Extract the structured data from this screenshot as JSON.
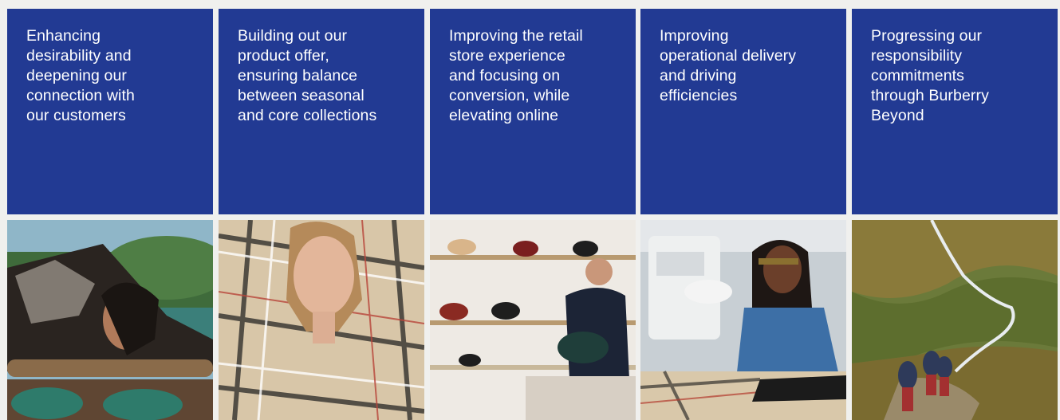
{
  "pillars": [
    {
      "text": "Enhancing\ndesirability and\ndeepening our\nconnection with\nour customers",
      "image": "woman-on-log-photo"
    },
    {
      "text": "Building out our\nproduct offer,\nensuring balance\nbetween seasonal\nand core collections",
      "image": "woman-in-check-photo"
    },
    {
      "text": "Improving the retail\nstore experience\nand focusing on\nconversion, while\nelevating online",
      "image": "store-associate-photo"
    },
    {
      "text": "Improving\noperational delivery\nand driving\nefficiencies",
      "image": "seamstress-photo"
    },
    {
      "text": "Progressing our\nresponsibility\ncommitments\nthrough Burberry\nBeyond",
      "image": "hikers-valley-photo"
    }
  ],
  "colors": {
    "card_background": "#223a93",
    "card_text": "#ffffff",
    "page_background": "#f0f0ee"
  }
}
